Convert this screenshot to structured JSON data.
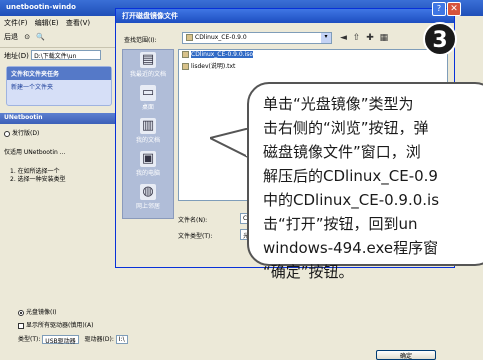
{
  "bg_window": {
    "title": "unetbootin-windo",
    "menu": [
      "文件(F)",
      "编辑(E)",
      "查看(V)"
    ],
    "toolbar": [
      "后退",
      "⊙",
      "🔍"
    ],
    "address_label": "地址(D)",
    "address_value": "D:\\下载文件\\un",
    "panel_header": "文件和文件夹任务",
    "panel_item": "新建一个文件夹"
  },
  "app": {
    "title": "UNetbootin",
    "radio_distribution": "发行版(D)",
    "desc_line": "仅适用 UNetbootin ...",
    "list_items": [
      "1. 在如所选择一个",
      "2. 选择一种安装类型"
    ]
  },
  "dialog": {
    "title": "打开磁盘镜像文件",
    "lookin_label": "查找范围(I):",
    "lookin_value": "CDlinux_CE-0.9.0",
    "places": [
      {
        "label": "我最近的文档",
        "icon": "recent-docs-icon"
      },
      {
        "label": "桌面",
        "icon": "desktop-icon"
      },
      {
        "label": "我的文档",
        "icon": "my-documents-icon"
      },
      {
        "label": "我的电脑",
        "icon": "my-computer-icon"
      },
      {
        "label": "网上邻居",
        "icon": "network-icon"
      }
    ],
    "files": [
      {
        "name": "CDlinux_CE-0.9.0.iso",
        "selected": true
      },
      {
        "name": "lisdev(说明).txt",
        "selected": false
      }
    ],
    "filename_label": "文件名(N):",
    "filename_value": "C",
    "filetype_label": "文件类型(T):",
    "filetype_value": "光"
  },
  "bottom": {
    "radio_disk_image": "光盘镜像(I)",
    "checkbox_show_all": "显示所有驱动器(慎用)(A)",
    "type_label": "类型(T):",
    "type_value": "USB驱动器",
    "drive_label": "驱动器(D):",
    "drive_value": "I:\\",
    "ok_label": "确定"
  },
  "step_number": "3",
  "callout_lines": [
    "单击“光盘镜像”类型为",
    "击右侧的“浏览”按钮，弹",
    "磁盘镜像文件”窗口，浏",
    "解压后的CDlinux_CE-0.9",
    "中的CDlinux_CE-0.9.0.is",
    "击“打开”按钮，回到un",
    "windows-494.exe程序窗",
    "“确定”按钮。"
  ]
}
